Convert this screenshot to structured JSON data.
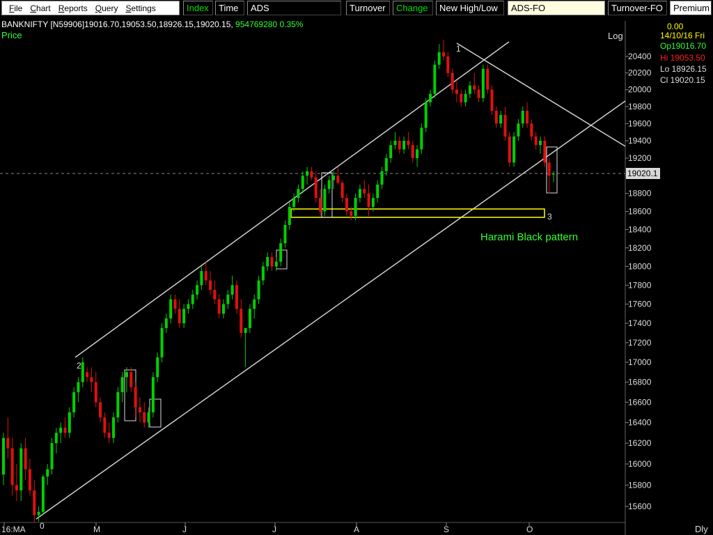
{
  "menu": [
    "File",
    "Chart",
    "Reports",
    "Query",
    "Settings"
  ],
  "toolbar": {
    "index": "Index",
    "time": "Time",
    "ads": "ADS",
    "turnover": "Turnover",
    "change": "Change",
    "new_high_low": "New High/Low",
    "ads_fo": "ADS-FO",
    "turnover_fo": "Turnover-FO",
    "premium": "Premium"
  },
  "info_bar": {
    "symbol_ohlc": "BANKNIFTY [N59906]19016.70,19053.50,18926.15,19020.15,",
    "volume_change": "954769280  0.35%"
  },
  "price_label": "Price",
  "scale_label": "Log",
  "right_panel": {
    "value": "0.00",
    "date": "14/10/16 Fri",
    "open": "Op19016.70",
    "high": "Hi 19053.50",
    "low": "Lo 18926.15",
    "close": "Cl 19020.15"
  },
  "current_price_tag": "19020.1",
  "interval_label": "Dly",
  "colors": {
    "up": "#00d000",
    "down": "#e01010",
    "trend": "#cfcfcf",
    "zone": "#ffff00",
    "annotation": "#33ff33"
  },
  "chart_data": {
    "type": "candlestick",
    "y_scale": "log",
    "ylim": [
      15430,
      20700
    ],
    "yticks": [
      15600,
      15800,
      16000,
      16200,
      16400,
      16600,
      16800,
      17000,
      17200,
      17400,
      17600,
      17800,
      18000,
      18200,
      18400,
      18600,
      18800,
      19000,
      19200,
      19400,
      19600,
      19800,
      20000,
      20200,
      20400
    ],
    "x_labels": [
      "16:MA",
      "M",
      "J",
      "J",
      "A",
      "S",
      "O"
    ],
    "candles": [
      [
        15900,
        16300,
        15800,
        16250
      ],
      [
        16250,
        16450,
        16050,
        16150
      ],
      [
        16150,
        16250,
        15700,
        15800
      ],
      [
        15800,
        16000,
        15650,
        15750
      ],
      [
        15750,
        16200,
        15650,
        16150
      ],
      [
        16150,
        16250,
        15850,
        15950
      ],
      [
        15950,
        16050,
        15700,
        15750
      ],
      [
        15750,
        15850,
        15450,
        15520
      ],
      [
        15520,
        15600,
        15460,
        15550
      ],
      [
        15550,
        15900,
        15520,
        15880
      ],
      [
        15880,
        16000,
        15800,
        15950
      ],
      [
        15950,
        16250,
        15900,
        16200
      ],
      [
        16200,
        16350,
        16100,
        16300
      ],
      [
        16300,
        16400,
        16200,
        16350
      ],
      [
        16350,
        16450,
        16250,
        16300
      ],
      [
        16300,
        16550,
        16250,
        16500
      ],
      [
        16500,
        16750,
        16450,
        16700
      ],
      [
        16700,
        16850,
        16600,
        16800
      ],
      [
        16800,
        17050,
        16750,
        17000
      ],
      [
        16900,
        16950,
        16800,
        16850
      ],
      [
        16850,
        16950,
        16700,
        16800
      ],
      [
        16800,
        16900,
        16550,
        16600
      ],
      [
        16600,
        16650,
        16400,
        16450
      ],
      [
        16450,
        16500,
        16250,
        16300
      ],
      [
        16300,
        16400,
        16200,
        16250
      ],
      [
        16250,
        16500,
        16200,
        16450
      ],
      [
        16450,
        16750,
        16400,
        16700
      ],
      [
        16700,
        16900,
        16600,
        16850
      ],
      [
        16850,
        16950,
        16700,
        16900
      ],
      [
        16900,
        16950,
        16700,
        16750
      ],
      [
        16750,
        16800,
        16450,
        16550
      ],
      [
        16550,
        16650,
        16400,
        16500
      ],
      [
        16500,
        16600,
        16350,
        16400
      ],
      [
        16400,
        16550,
        16350,
        16500
      ],
      [
        16500,
        16900,
        16450,
        16850
      ],
      [
        16850,
        17100,
        16800,
        17050
      ],
      [
        17050,
        17400,
        17000,
        17350
      ],
      [
        17350,
        17500,
        17300,
        17450
      ],
      [
        17450,
        17700,
        17400,
        17650
      ],
      [
        17650,
        17700,
        17500,
        17550
      ],
      [
        17550,
        17650,
        17350,
        17400
      ],
      [
        17400,
        17600,
        17350,
        17550
      ],
      [
        17550,
        17650,
        17500,
        17600
      ],
      [
        17600,
        17750,
        17550,
        17700
      ],
      [
        17700,
        17850,
        17650,
        17800
      ],
      [
        17800,
        18000,
        17750,
        17950
      ],
      [
        17950,
        18050,
        17800,
        17850
      ],
      [
        17850,
        17950,
        17700,
        17750
      ],
      [
        17750,
        17850,
        17600,
        17650
      ],
      [
        17650,
        17700,
        17450,
        17500
      ],
      [
        17500,
        17650,
        17450,
        17600
      ],
      [
        17600,
        17750,
        17550,
        17700
      ],
      [
        17700,
        17900,
        17650,
        17800
      ],
      [
        17800,
        17850,
        17500,
        17550
      ],
      [
        17550,
        17650,
        17250,
        17300
      ],
      [
        17300,
        17350,
        16950,
        17350
      ],
      [
        17350,
        17600,
        17300,
        17550
      ],
      [
        17550,
        17700,
        17450,
        17650
      ],
      [
        17650,
        17900,
        17600,
        17850
      ],
      [
        17850,
        18050,
        17800,
        18000
      ],
      [
        18000,
        18150,
        17950,
        18100
      ],
      [
        18100,
        18150,
        17950,
        18000
      ],
      [
        18000,
        18100,
        17950,
        18050
      ],
      [
        18050,
        18300,
        18000,
        18250
      ],
      [
        18250,
        18500,
        18200,
        18450
      ],
      [
        18450,
        18700,
        18400,
        18650
      ],
      [
        18650,
        18800,
        18600,
        18750
      ],
      [
        18750,
        18900,
        18700,
        18850
      ],
      [
        18850,
        19050,
        18800,
        19000
      ],
      [
        19000,
        19100,
        18900,
        19050
      ],
      [
        19050,
        19100,
        18950,
        18980
      ],
      [
        18980,
        19050,
        18700,
        18750
      ],
      [
        18750,
        18850,
        18550,
        18600
      ],
      [
        18600,
        18900,
        18550,
        18850
      ],
      [
        18850,
        19000,
        18800,
        18950
      ],
      [
        18950,
        19050,
        18850,
        19000
      ],
      [
        19000,
        19100,
        18900,
        18920
      ],
      [
        18920,
        18950,
        18700,
        18750
      ],
      [
        18750,
        18800,
        18550,
        18600
      ],
      [
        18600,
        18650,
        18500,
        18550
      ],
      [
        18550,
        18800,
        18500,
        18750
      ],
      [
        18750,
        18900,
        18700,
        18850
      ],
      [
        18850,
        18950,
        18750,
        18800
      ],
      [
        18800,
        18900,
        18550,
        18650
      ],
      [
        18650,
        18800,
        18600,
        18750
      ],
      [
        18750,
        18950,
        18700,
        18900
      ],
      [
        18900,
        19100,
        18850,
        19050
      ],
      [
        19050,
        19250,
        19000,
        19200
      ],
      [
        19200,
        19400,
        19150,
        19350
      ],
      [
        19350,
        19500,
        19300,
        19400
      ],
      [
        19400,
        19450,
        19250,
        19300
      ],
      [
        19300,
        19450,
        19250,
        19400
      ],
      [
        19400,
        19500,
        19300,
        19350
      ],
      [
        19350,
        19400,
        19150,
        19200
      ],
      [
        19200,
        19350,
        19100,
        19300
      ],
      [
        19300,
        19600,
        19250,
        19550
      ],
      [
        19550,
        19900,
        19500,
        19850
      ],
      [
        19850,
        20000,
        19800,
        19950
      ],
      [
        19950,
        20350,
        19900,
        20300
      ],
      [
        20300,
        20550,
        20250,
        20450
      ],
      [
        20450,
        20600,
        20350,
        20400
      ],
      [
        20400,
        20450,
        20150,
        20200
      ],
      [
        20200,
        20250,
        19950,
        20000
      ],
      [
        20000,
        20100,
        19850,
        19950
      ],
      [
        19950,
        20000,
        19800,
        19850
      ],
      [
        19850,
        20000,
        19800,
        19950
      ],
      [
        19950,
        20100,
        19900,
        20050
      ],
      [
        20050,
        20200,
        19950,
        20000
      ],
      [
        20000,
        20050,
        19850,
        19900
      ],
      [
        19900,
        20300,
        19850,
        20250
      ],
      [
        20250,
        20300,
        19950,
        20000
      ],
      [
        20000,
        20050,
        19700,
        19750
      ],
      [
        19750,
        19800,
        19550,
        19600
      ],
      [
        19600,
        19750,
        19550,
        19700
      ],
      [
        19700,
        19800,
        19400,
        19450
      ],
      [
        19450,
        19500,
        19100,
        19150
      ],
      [
        19150,
        19500,
        19100,
        19450
      ],
      [
        19450,
        19650,
        19400,
        19600
      ],
      [
        19600,
        19800,
        19550,
        19750
      ],
      [
        19750,
        19850,
        19550,
        19600
      ],
      [
        19600,
        19650,
        19400,
        19450
      ],
      [
        19450,
        19500,
        19300,
        19350
      ],
      [
        19350,
        19450,
        19250,
        19400
      ],
      [
        19400,
        19450,
        19100,
        19150
      ],
      [
        19150,
        19200,
        18800,
        19000
      ],
      [
        19016.7,
        19053.5,
        18926.15,
        19020.15
      ]
    ],
    "annotations": [
      {
        "kind": "label",
        "text": "2"
      },
      {
        "kind": "label",
        "text": "0"
      },
      {
        "kind": "label",
        "text": "1"
      },
      {
        "kind": "label",
        "text": "3"
      },
      {
        "kind": "label",
        "text": "Harami Black pattern"
      }
    ]
  }
}
